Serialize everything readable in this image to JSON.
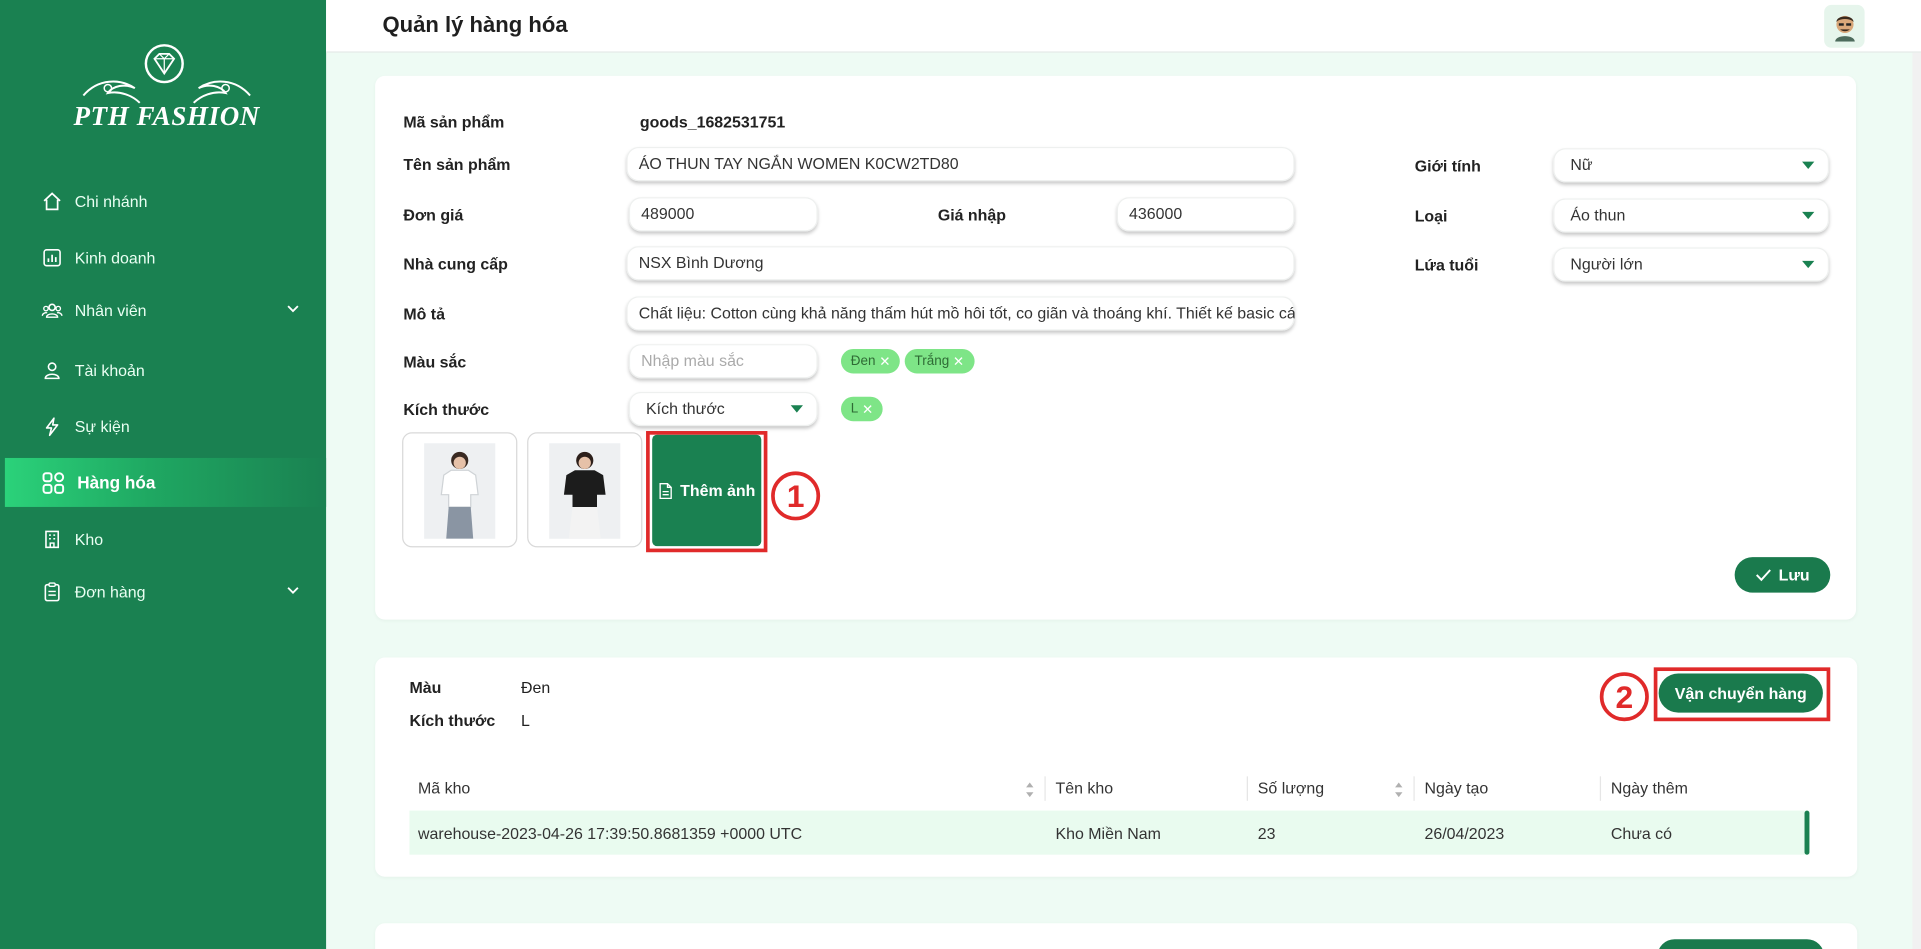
{
  "brand": {
    "logo_text": "PTH FASHION"
  },
  "sidebar": {
    "items": [
      {
        "label": "Chi nhánh",
        "icon": "home-icon"
      },
      {
        "label": "Kinh doanh",
        "icon": "bar-chart-icon"
      },
      {
        "label": "Nhân viên",
        "icon": "users-icon",
        "expandable": true
      },
      {
        "label": "Tài khoản",
        "icon": "user-account-icon"
      },
      {
        "label": "Sự kiện",
        "icon": "lightning-icon"
      },
      {
        "label": "Hàng hóa",
        "icon": "grid-icon",
        "active": true
      },
      {
        "label": "Kho",
        "icon": "building-icon"
      },
      {
        "label": "Đơn hàng",
        "icon": "clipboard-icon",
        "expandable": true
      }
    ]
  },
  "header": {
    "title": "Quản lý hàng hóa"
  },
  "form": {
    "code_label": "Mã sản phẩm",
    "code_value": "goods_1682531751",
    "name_label": "Tên sản phẩm",
    "name_value": "ÁO THUN TAY NGẮN WOMEN K0CW2TD80",
    "price_label": "Đơn giá",
    "price_value": "489000",
    "cost_label": "Giá nhập",
    "cost_value": "436000",
    "supplier_label": "Nhà cung cấp",
    "supplier_value": "NSX Bình Dương",
    "desc_label": "Mô tả",
    "desc_value": "Chất liệu: Cotton cùng khả năng thấm hút mồ hôi tốt, co giãn và thoáng khí. Thiết kế basic cá",
    "color_label": "Màu sắc",
    "color_placeholder": "Nhập màu sắc",
    "color_tags": [
      "Đen",
      "Trắng"
    ],
    "size_label": "Kích thước",
    "size_select": "Kích thước",
    "size_tags": [
      "L"
    ],
    "gender_label": "Giới tính",
    "gender_value": "Nữ",
    "type_label": "Loại",
    "type_value": "Áo thun",
    "age_label": "Lứa tuổi",
    "age_value": "Người lớn",
    "add_image_label": "Thêm ảnh",
    "save_label": "Lưu",
    "annotation_1": "1"
  },
  "variant": {
    "color_label": "Màu",
    "color_value": "Đen",
    "size_label": "Kích thước",
    "size_value": "L",
    "ship_label": "Vận chuyển hàng",
    "annotation_2": "2",
    "table": {
      "columns": [
        "Mã kho",
        "Tên kho",
        "Số lượng",
        "Ngày tạo",
        "Ngày thêm"
      ],
      "rows": [
        [
          "warehouse-2023-04-26 17:39:50.8681359 +0000 UTC",
          "Kho Miền Nam",
          "23",
          "26/04/2023",
          "Chưa có"
        ]
      ]
    }
  },
  "colors": {
    "primary": "#1a8151",
    "accent": "#2bd27a",
    "tag": "#7ee587",
    "annotation": "#e02a2a",
    "page_bg": "#eefbf4"
  }
}
